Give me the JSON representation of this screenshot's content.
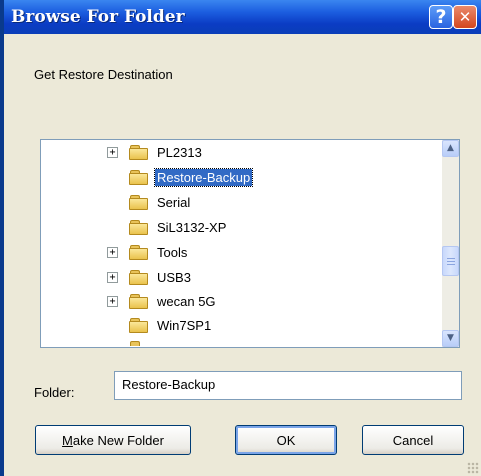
{
  "window": {
    "title": "Browse For Folder",
    "help_glyph": "?",
    "close_glyph": "✕"
  },
  "prompt": "Get Restore Destination",
  "tree": {
    "items": [
      {
        "label": "PL2313",
        "expandable": true,
        "selected": false
      },
      {
        "label": "Restore-Backup",
        "expandable": false,
        "selected": true
      },
      {
        "label": "Serial",
        "expandable": false,
        "selected": false
      },
      {
        "label": "SiL3132-XP",
        "expandable": false,
        "selected": false
      },
      {
        "label": "Tools",
        "expandable": true,
        "selected": false
      },
      {
        "label": "USB3",
        "expandable": true,
        "selected": false
      },
      {
        "label": "wecan 5G",
        "expandable": true,
        "selected": false
      },
      {
        "label": "Win7SP1",
        "expandable": false,
        "selected": false
      }
    ],
    "expander_glyph": "+",
    "scroll_up_glyph": "▲",
    "scroll_down_glyph": "▼"
  },
  "folder": {
    "label": "Folder:",
    "value": "Restore-Backup"
  },
  "buttons": {
    "new_folder_mnemonic": "M",
    "new_folder_rest": "ake New Folder",
    "ok": "OK",
    "cancel": "Cancel"
  }
}
